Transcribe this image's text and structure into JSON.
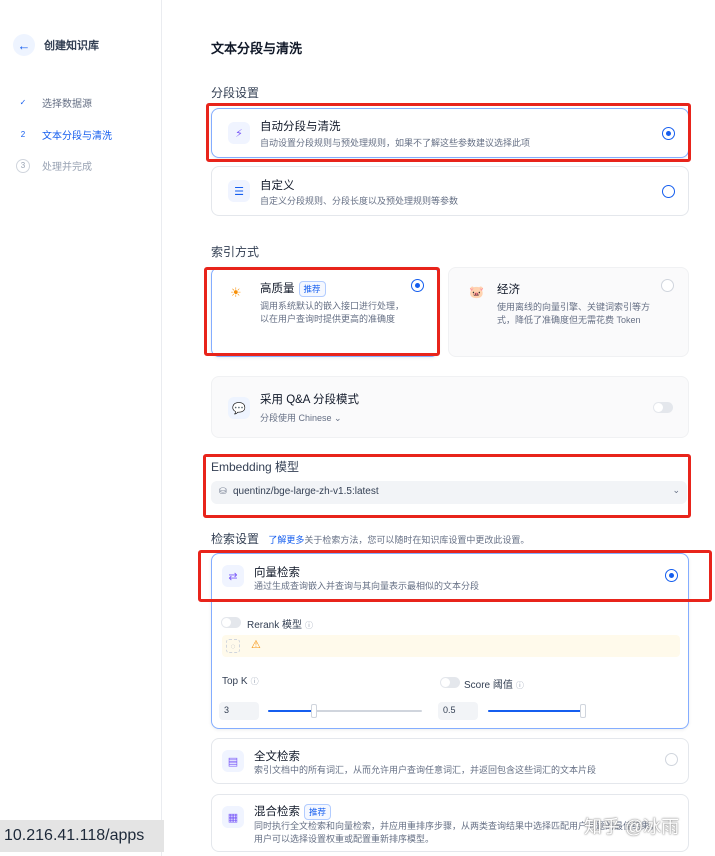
{
  "sidebar": {
    "back_icon": "arrow-left-icon",
    "title": "创建知识库",
    "steps": [
      {
        "marker": "✓",
        "label": "选择数据源"
      },
      {
        "marker": "2",
        "label": "文本分段与清洗"
      },
      {
        "marker": "3",
        "label": "处理并完成"
      }
    ]
  },
  "main": {
    "title": "文本分段与清洗",
    "segment": {
      "label": "分段设置",
      "auto": {
        "title": "自动分段与清洗",
        "desc": "自动设置分段规则与预处理规则，如果不了解这些参数建议选择此项",
        "icon": "lightning-icon"
      },
      "custom": {
        "title": "自定义",
        "desc": "自定义分段规则、分段长度以及预处理规则等参数",
        "icon": "sliders-icon"
      }
    },
    "index": {
      "label": "索引方式",
      "high": {
        "title": "高质量",
        "badge": "推荐",
        "desc1": "调用系统默认的嵌入接口进行处理，",
        "desc2": "以在用户查询时提供更高的准确度",
        "icon": "sun-icon"
      },
      "economy": {
        "title": "经济",
        "desc1": "使用离线的向量引擎、关键词索引等方",
        "desc2": "式，降低了准确度但无需花费 Token",
        "icon": "piggy-bank-icon"
      }
    },
    "qa": {
      "title": "采用 Q&A 分段模式",
      "sub": "分段使用 Chinese",
      "chevron": "⌄"
    },
    "embedding": {
      "label": "Embedding 模型",
      "value": "quentinz/bge-large-zh-v1.5:latest",
      "chevron": "⌄"
    },
    "retrieval": {
      "label": "检索设置",
      "link": "了解更多",
      "hint": "关于检索方法，您可以随时在知识库设置中更改此设置。",
      "vector": {
        "title": "向量检索",
        "desc": "通过生成查询嵌入并查询与其向量表示最相似的文本分段"
      },
      "rerank": {
        "label": "Rerank 模型"
      },
      "topk": {
        "label": "Top K",
        "value": "3",
        "level": 0.3
      },
      "score": {
        "label": "Score 阈值",
        "value": "0.5",
        "level": 0.97
      },
      "fulltext": {
        "title": "全文检索",
        "desc": "索引文档中的所有词汇，从而允许用户查询任意词汇，并返回包含这些词汇的文本片段"
      },
      "hybrid": {
        "title": "混合检索",
        "badge": "推荐",
        "desc1": "同时执行全文检索和向量检索，并应用重排序步骤，从两类查询结果中选择匹配用户问题的最佳结果，",
        "desc2": "用户可以选择设置权重或配置重新排序模型。"
      }
    }
  },
  "overlay": {
    "url": "10.216.41.118/apps",
    "watermark": "知乎 @冰雨"
  },
  "colors": {
    "accent": "#155eef",
    "highlight": "#e8241b"
  }
}
